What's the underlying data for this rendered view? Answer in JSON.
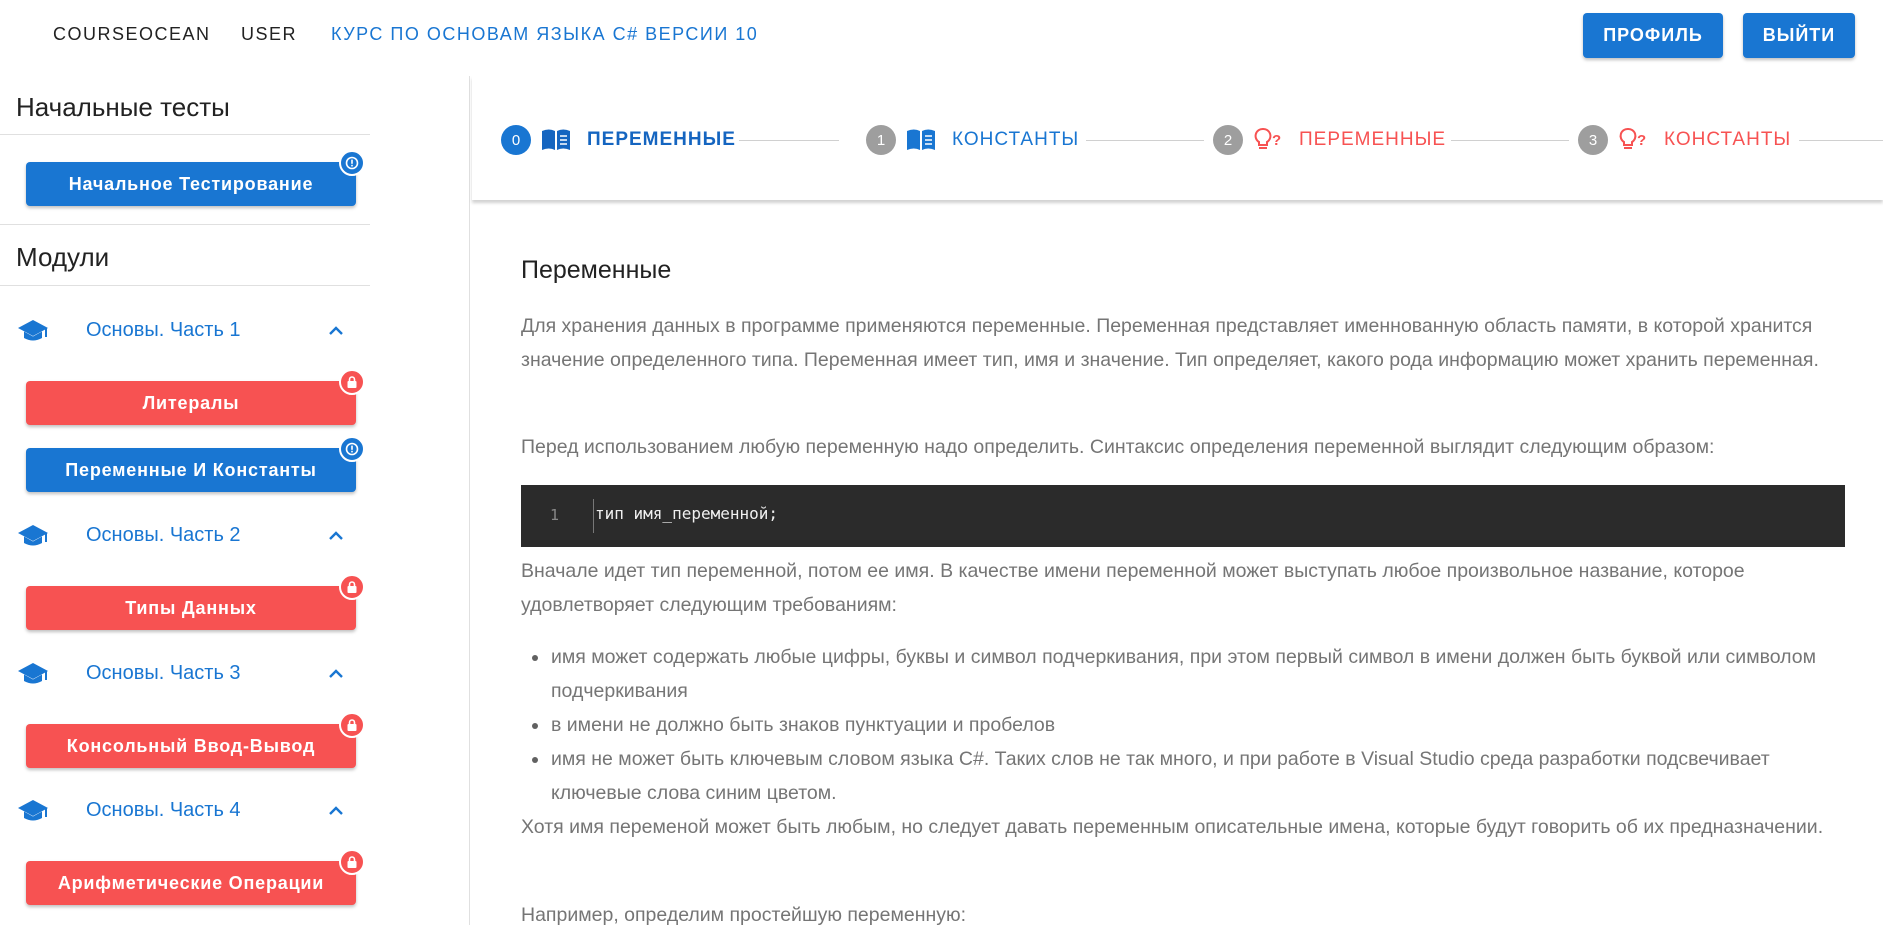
{
  "topbar": {
    "brand": "COURSEOCEAN",
    "user": "USER",
    "course": "КУРС ПО ОСНОВАМ ЯЗЫКА C# ВЕРСИИ 10",
    "profile_button": "ПРОФИЛЬ",
    "logout_button": "ВЫЙТИ"
  },
  "sidebar": {
    "initial_tests_title": "Начальные тесты",
    "initial_test_button": "Начальное Тестирование",
    "modules_title": "Модули",
    "modules": [
      {
        "label": "Основы. Часть 1",
        "lessons": [
          {
            "label": "Литералы",
            "status": "locked"
          },
          {
            "label": "Переменные И Константы",
            "status": "info"
          }
        ]
      },
      {
        "label": "Основы. Часть 2",
        "lessons": [
          {
            "label": "Типы Данных",
            "status": "locked"
          }
        ]
      },
      {
        "label": "Основы. Часть 3",
        "lessons": [
          {
            "label": "Консольный Ввод-Вывод",
            "status": "locked"
          }
        ]
      },
      {
        "label": "Основы. Часть 4",
        "lessons": [
          {
            "label": "Арифметические Операции",
            "status": "locked"
          }
        ]
      }
    ]
  },
  "stepper": {
    "steps": [
      {
        "number": "0",
        "icon": "book-icon",
        "label": "ПЕРЕМЕННЫЕ",
        "state": "active"
      },
      {
        "number": "1",
        "icon": "book-icon",
        "label": "КОНСТАНТЫ",
        "state": "theory"
      },
      {
        "number": "2",
        "icon": "lightbulb-question-icon",
        "label": "ПЕРЕМЕННЫЕ",
        "state": "test"
      },
      {
        "number": "3",
        "icon": "lightbulb-question-icon",
        "label": "КОНСТАНТЫ",
        "state": "test"
      }
    ]
  },
  "lesson": {
    "title": "Переменные",
    "p1": "Для хранения данных в программе применяются переменные. Переменная представляет именнованную область памяти, в которой хранится значение определенного типа. Переменная имеет тип, имя и значение. Тип определяет, какого рода информацию может хранить переменная.",
    "p2": "Перед использованием любую переменную надо определить. Синтаксис определения переменной выглядит следующим образом:",
    "code": {
      "line_number": "1",
      "text": "тип имя_переменной;"
    },
    "p3": "Вначале идет тип переменной, потом ее имя. В качестве имени переменной может выступать любое произвольное название, которое удовлетворяет следующим требованиям:",
    "bullets": [
      "имя может содержать любые цифры, буквы и символ подчеркивания, при этом первый символ в имени должен быть буквой или символом подчеркивания",
      "в имени не должно быть знаков пунктуации и пробелов",
      "имя не может быть ключевым словом языка C#. Таких слов не так много, и при работе в Visual Studio среда разработки подсвечивает ключевые слова синим цветом."
    ],
    "p4": "Хотя имя переменой может быть любым, но следует давать переменным описательные имена, которые будут говорить об их предназначении.",
    "p5": "Например, определим простейшую переменную:"
  },
  "colors": {
    "primary": "#1976d2",
    "locked": "#f75252",
    "muted_text": "#757575",
    "code_bg": "#2b2b2b"
  }
}
